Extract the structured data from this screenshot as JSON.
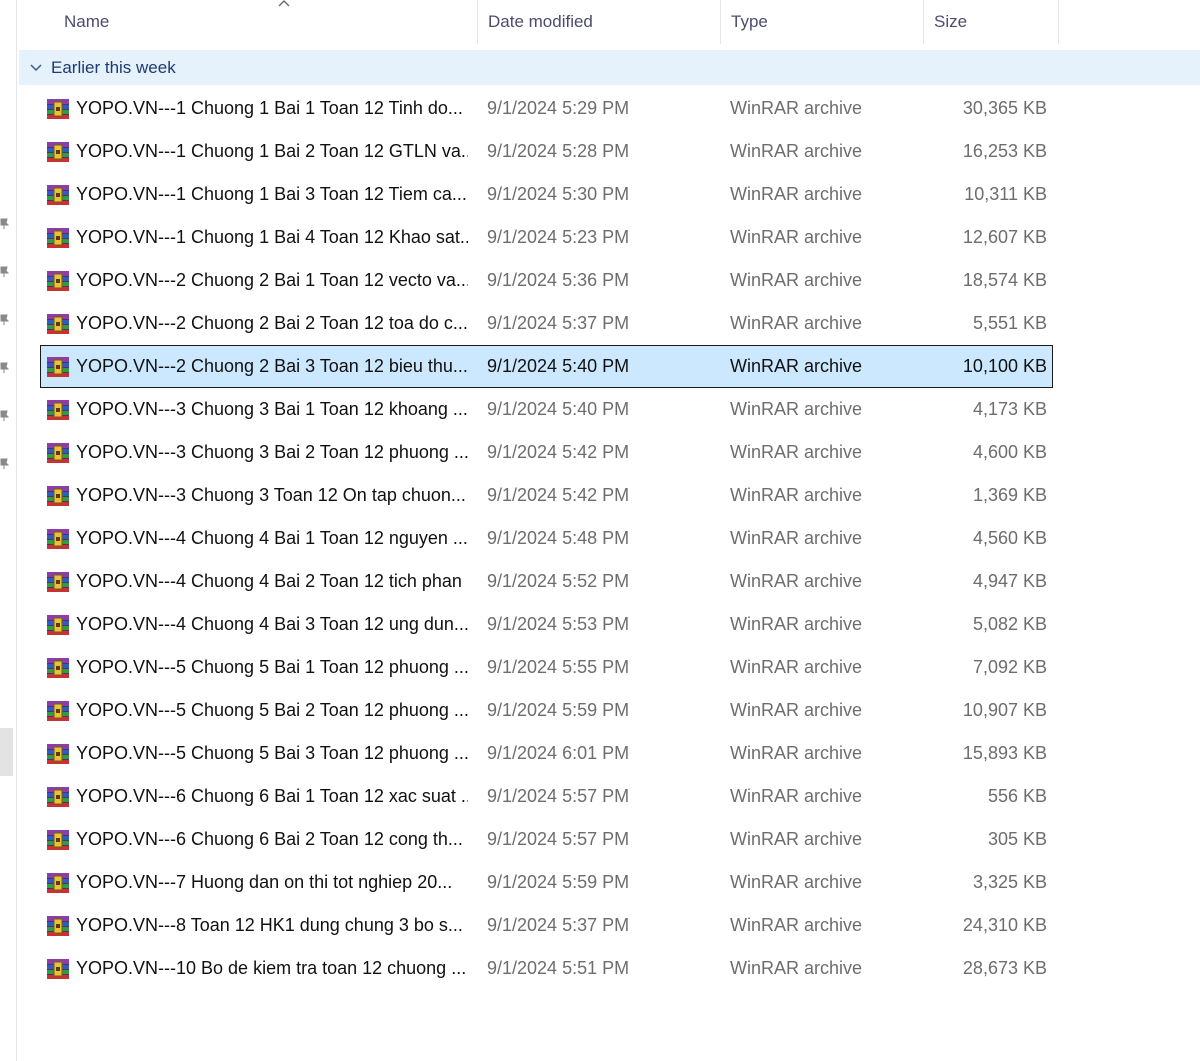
{
  "columns": {
    "name": "Name",
    "date": "Date modified",
    "type": "Type",
    "size": "Size"
  },
  "group": {
    "label": "Earlier this week"
  },
  "icons": {
    "file": "winrar-archive-icon",
    "sort": "sort-ascending-icon",
    "group": "chevron-down-icon",
    "pin": "pin-icon"
  },
  "colors": {
    "selection": "#cce8ff",
    "group_bg": "#e5f1fb"
  },
  "selected_index": 6,
  "files": [
    {
      "name": "YOPO.VN---1  Chuong 1 Bai 1 Toan 12 Tinh do...",
      "date": "9/1/2024 5:29 PM",
      "type": "WinRAR archive",
      "size": "30,365 KB"
    },
    {
      "name": "YOPO.VN---1  Chuong 1 Bai 2 Toan 12 GTLN va...",
      "date": "9/1/2024 5:28 PM",
      "type": "WinRAR archive",
      "size": "16,253 KB"
    },
    {
      "name": "YOPO.VN---1  Chuong 1 Bai 3 Toan 12 Tiem ca...",
      "date": "9/1/2024 5:30 PM",
      "type": "WinRAR archive",
      "size": "10,311 KB"
    },
    {
      "name": "YOPO.VN---1  Chuong 1 Bai 4 Toan 12 Khao sat...",
      "date": "9/1/2024 5:23 PM",
      "type": "WinRAR archive",
      "size": "12,607 KB"
    },
    {
      "name": "YOPO.VN---2  Chuong 2 Bai 1 Toan 12 vecto va...",
      "date": "9/1/2024 5:36 PM",
      "type": "WinRAR archive",
      "size": "18,574 KB"
    },
    {
      "name": "YOPO.VN---2  Chuong 2 Bai 2 Toan 12 toa do c...",
      "date": "9/1/2024 5:37 PM",
      "type": "WinRAR archive",
      "size": "5,551 KB"
    },
    {
      "name": "YOPO.VN---2  Chuong 2 Bai 3 Toan 12 bieu thu...",
      "date": "9/1/2024 5:40 PM",
      "type": "WinRAR archive",
      "size": "10,100 KB"
    },
    {
      "name": "YOPO.VN---3  Chuong 3 Bai 1 Toan 12 khoang ...",
      "date": "9/1/2024 5:40 PM",
      "type": "WinRAR archive",
      "size": "4,173 KB"
    },
    {
      "name": "YOPO.VN---3  Chuong 3 Bai 2 Toan 12 phuong ...",
      "date": "9/1/2024 5:42 PM",
      "type": "WinRAR archive",
      "size": "4,600 KB"
    },
    {
      "name": "YOPO.VN---3  Chuong 3 Toan 12 On tap chuon...",
      "date": "9/1/2024 5:42 PM",
      "type": "WinRAR archive",
      "size": "1,369 KB"
    },
    {
      "name": "YOPO.VN---4  Chuong 4 Bai 1 Toan 12 nguyen ...",
      "date": "9/1/2024 5:48 PM",
      "type": "WinRAR archive",
      "size": "4,560 KB"
    },
    {
      "name": "YOPO.VN---4  Chuong 4 Bai 2 Toan 12 tich phan",
      "date": "9/1/2024 5:52 PM",
      "type": "WinRAR archive",
      "size": "4,947 KB"
    },
    {
      "name": "YOPO.VN---4  Chuong 4 Bai 3 Toan 12 ung dun...",
      "date": "9/1/2024 5:53 PM",
      "type": "WinRAR archive",
      "size": "5,082 KB"
    },
    {
      "name": "YOPO.VN---5  Chuong 5 Bai 1 Toan 12 phuong ...",
      "date": "9/1/2024 5:55 PM",
      "type": "WinRAR archive",
      "size": "7,092 KB"
    },
    {
      "name": "YOPO.VN---5  Chuong 5 Bai 2 Toan 12 phuong ...",
      "date": "9/1/2024 5:59 PM",
      "type": "WinRAR archive",
      "size": "10,907 KB"
    },
    {
      "name": "YOPO.VN---5  Chuong 5 Bai 3 Toan 12 phuong ...",
      "date": "9/1/2024 6:01 PM",
      "type": "WinRAR archive",
      "size": "15,893 KB"
    },
    {
      "name": "YOPO.VN---6  Chuong 6 Bai 1 Toan 12 xac suat ...",
      "date": "9/1/2024 5:57 PM",
      "type": "WinRAR archive",
      "size": "556 KB"
    },
    {
      "name": "YOPO.VN---6  Chuong 6 Bai 2 Toan 12 cong th...",
      "date": "9/1/2024 5:57 PM",
      "type": "WinRAR archive",
      "size": "305 KB"
    },
    {
      "name": "YOPO.VN---7  Huong dan on thi tot nghiep 20...",
      "date": "9/1/2024 5:59 PM",
      "type": "WinRAR archive",
      "size": "3,325 KB"
    },
    {
      "name": "YOPO.VN---8  Toan 12 HK1 dung chung 3 bo s...",
      "date": "9/1/2024 5:37 PM",
      "type": "WinRAR archive",
      "size": "24,310 KB"
    },
    {
      "name": "YOPO.VN---10  Bo de kiem tra toan 12 chuong ...",
      "date": "9/1/2024 5:51 PM",
      "type": "WinRAR archive",
      "size": "28,673 KB"
    }
  ]
}
